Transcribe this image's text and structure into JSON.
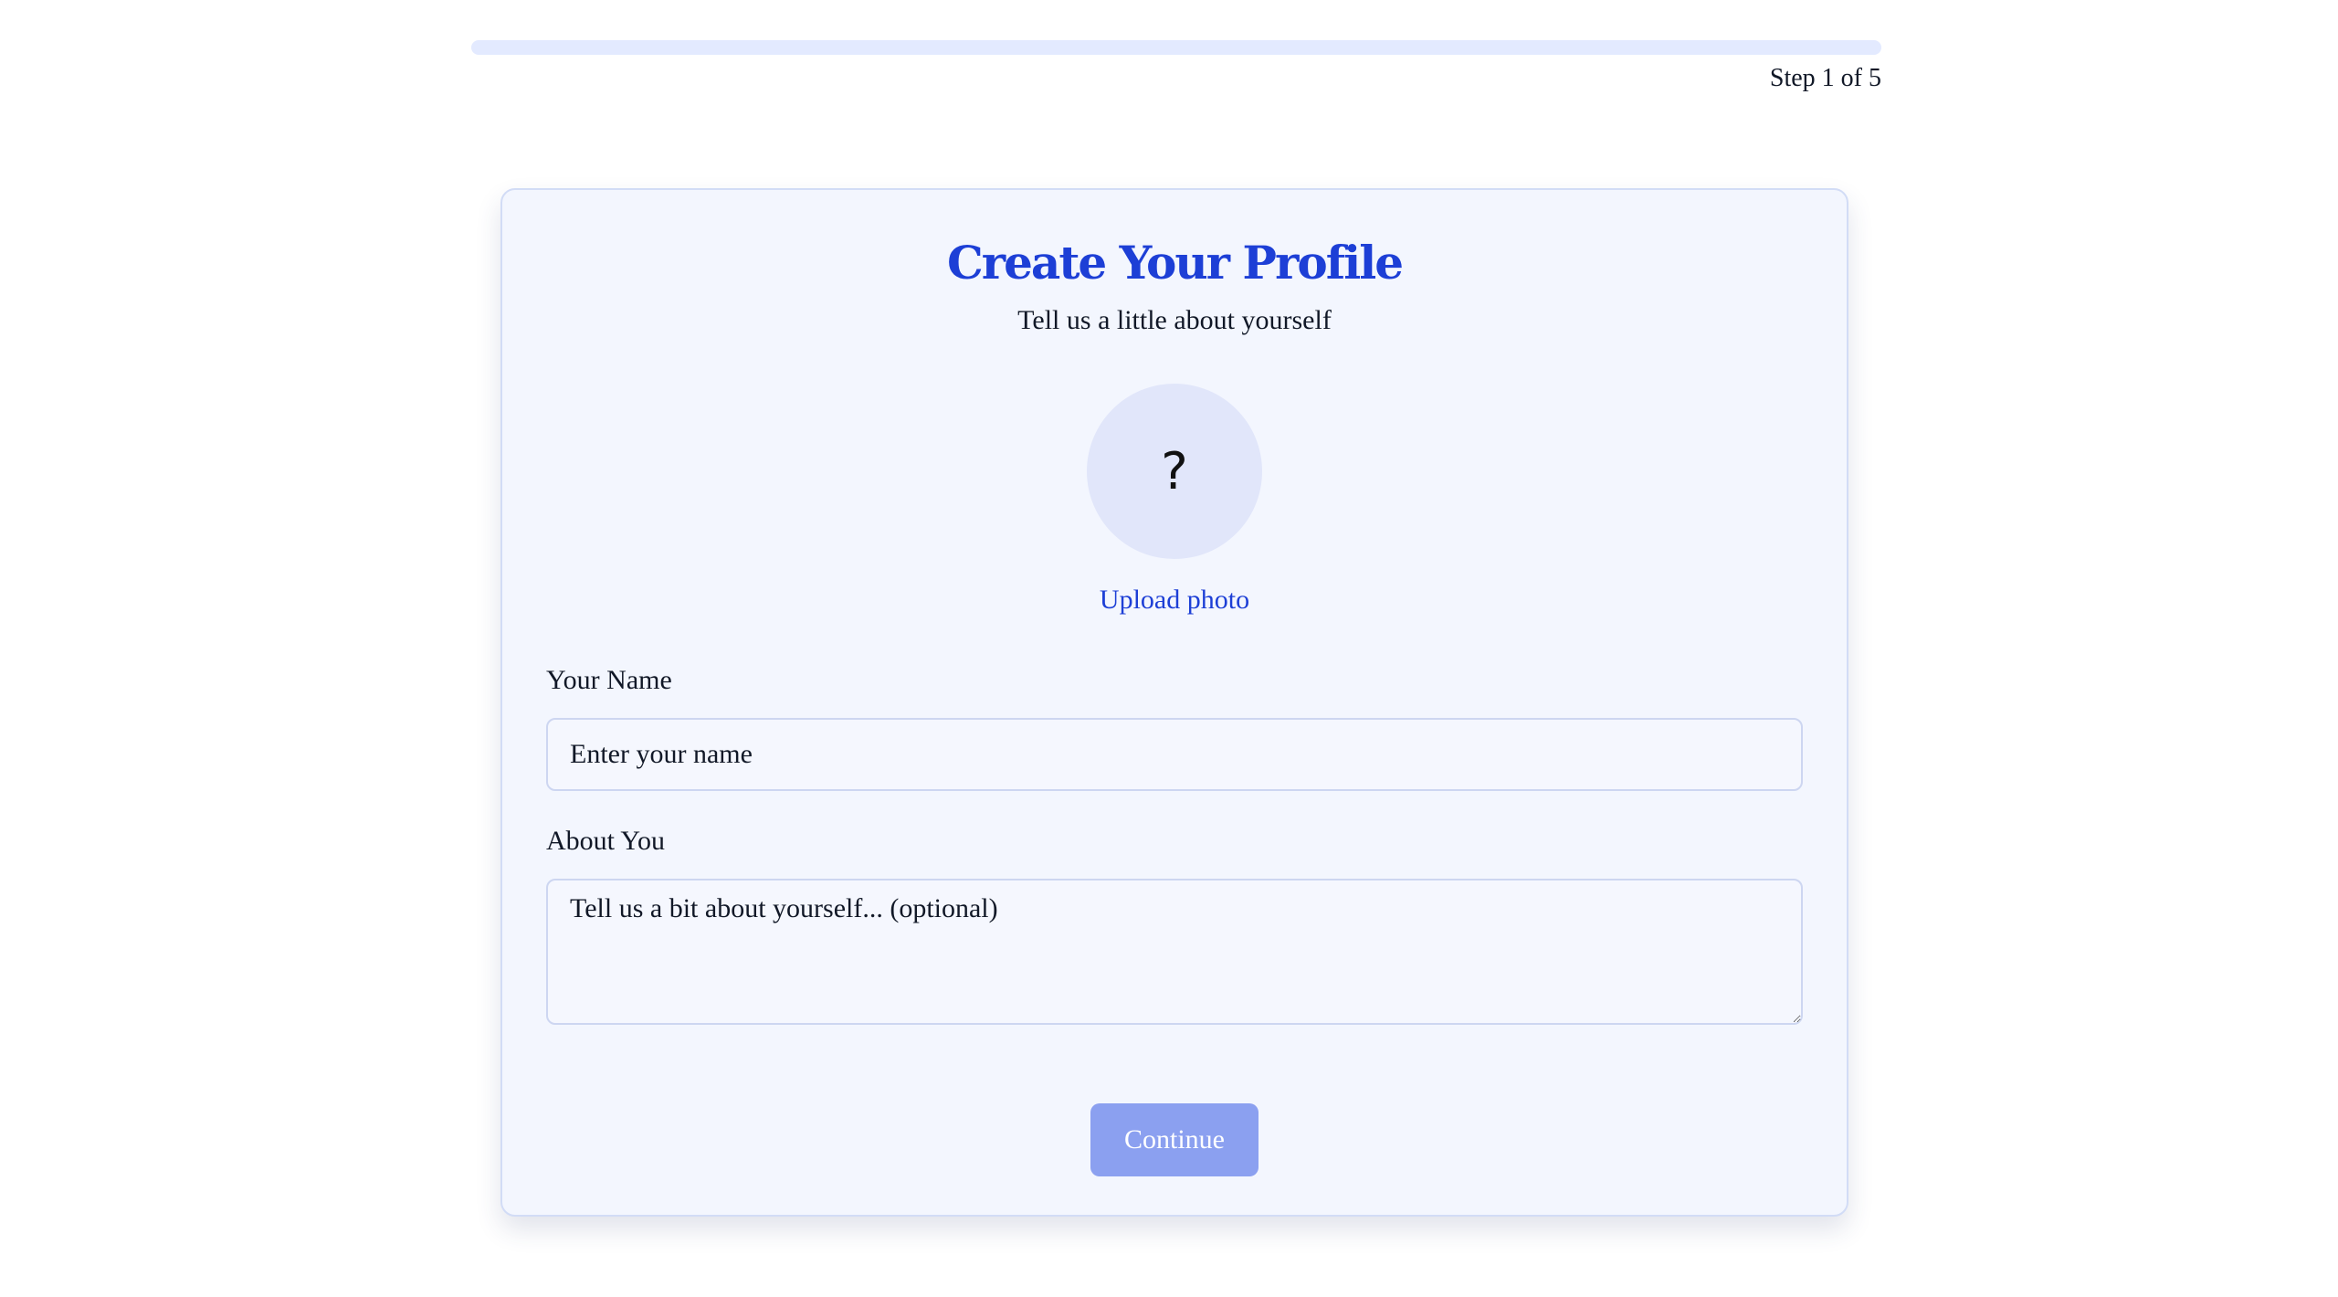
{
  "progress": {
    "step_text": "Step 1 of 5",
    "fraction": 0
  },
  "card": {
    "title": "Create Your Profile",
    "subtitle": "Tell us a little about yourself",
    "avatar": {
      "glyph": "?",
      "icon": "avatar-placeholder-question-icon"
    },
    "upload_label": "Upload photo"
  },
  "form": {
    "name": {
      "label": "Your Name",
      "placeholder": "Enter your name",
      "value": ""
    },
    "about": {
      "label": "About You",
      "placeholder": "Tell us a bit about yourself... (optional)",
      "value": ""
    },
    "continue_label": "Continue"
  },
  "colors": {
    "accent": "#1d3fd6",
    "button": "#8ba0f0",
    "card_background": "#f3f6fe",
    "progress_track": "#e3eaff"
  }
}
